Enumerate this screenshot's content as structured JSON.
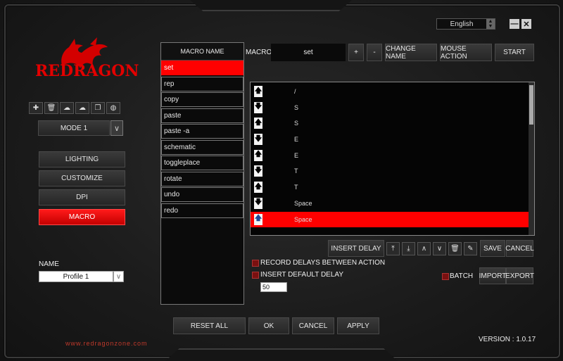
{
  "language": {
    "selected": "English"
  },
  "window": {
    "minimize_icon": "minimize-icon",
    "close_icon": "close-icon"
  },
  "brand": {
    "logo_text": "REDRAGON",
    "url": "www.redragonzone.com"
  },
  "profile_tools": [
    "add-icon",
    "delete-icon",
    "cloud-upload-icon",
    "cloud-download-icon",
    "copy-icon",
    "palette-icon"
  ],
  "mode": {
    "selected": "MODE 1"
  },
  "nav": {
    "lighting": "LIGHTING",
    "customize": "CUSTOMIZE",
    "dpi": "DPI",
    "macro": "MACRO"
  },
  "profile": {
    "label": "NAME",
    "value": "Profile 1"
  },
  "macro_list": {
    "header": "MACRO NAME",
    "items": [
      "set",
      "rep",
      "copy",
      "paste",
      "paste -a",
      "schematic",
      "toggleplace",
      "rotate",
      "undo",
      "redo"
    ],
    "selected_index": 0
  },
  "macro_bar": {
    "label": "MACRO",
    "name": "set",
    "plus": "+",
    "minus": "-",
    "change_name": "CHANGE NAME",
    "mouse_action": "MOUSE ACTION",
    "start": "START"
  },
  "events": [
    {
      "dir": "up",
      "key": "/"
    },
    {
      "dir": "down",
      "key": "S"
    },
    {
      "dir": "up",
      "key": "S"
    },
    {
      "dir": "down",
      "key": "E"
    },
    {
      "dir": "up",
      "key": "E"
    },
    {
      "dir": "down",
      "key": "T"
    },
    {
      "dir": "up",
      "key": "T"
    },
    {
      "dir": "down",
      "key": "Space"
    },
    {
      "dir": "up",
      "key": "Space",
      "selected": true
    }
  ],
  "editor": {
    "insert_delay": "INSERT DELAY",
    "save": "SAVE",
    "cancel": "CANCEL",
    "record_delays": "RECORD DELAYS BETWEEN ACTION",
    "insert_default_delay": "INSERT DEFAULT DELAY",
    "default_delay_value": "50",
    "batch": "BATCH",
    "import": "IMPORT",
    "export": "EXPORT"
  },
  "footer": {
    "reset_all": "RESET ALL",
    "ok": "OK",
    "cancel": "CANCEL",
    "apply": "APPLY",
    "version": "VERSION : 1.0.17"
  },
  "colors": {
    "accent": "#ff0000",
    "background": "#1a1a1a"
  }
}
